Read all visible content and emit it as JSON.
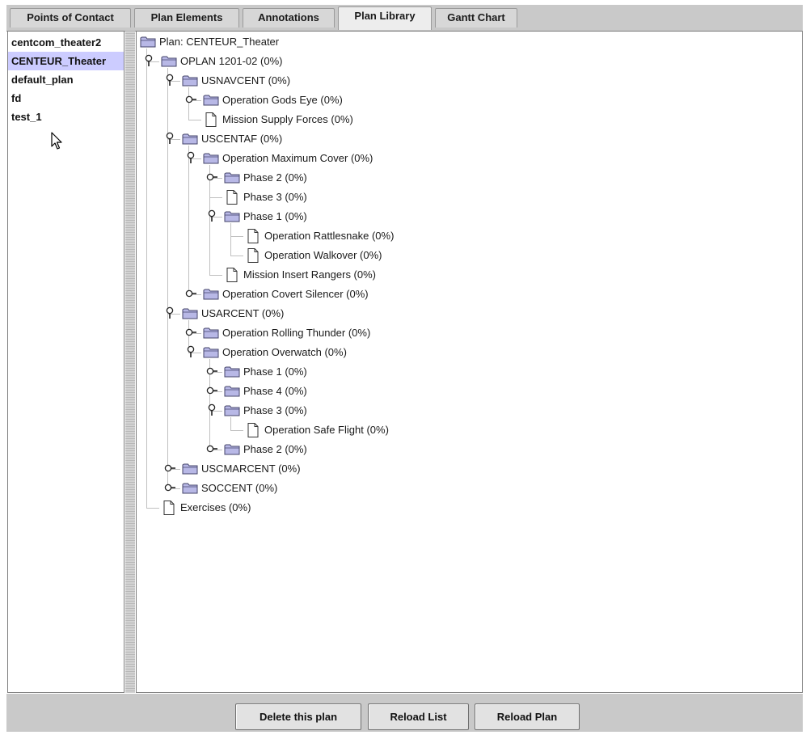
{
  "tabs": [
    {
      "label": "Points of Contact",
      "active": false
    },
    {
      "label": "Plan Elements",
      "active": false
    },
    {
      "label": "Annotations",
      "active": false
    },
    {
      "label": "Plan Library",
      "active": true
    },
    {
      "label": "Gantt Chart",
      "active": false
    }
  ],
  "plan_list": {
    "items": [
      {
        "label": "centcom_theater2",
        "selected": false
      },
      {
        "label": "CENTEUR_Theater",
        "selected": true
      },
      {
        "label": "default_plan",
        "selected": false
      },
      {
        "label": "fd",
        "selected": false
      },
      {
        "label": "test_1",
        "selected": false
      }
    ]
  },
  "tree": {
    "nodes": [
      {
        "label": "Plan: CENTEUR_Theater",
        "depth": 0,
        "icon": "folder-icon",
        "handle": "none"
      },
      {
        "label": "OPLAN 1201-02 (0%)",
        "depth": 1,
        "icon": "folder-icon",
        "handle": "expanded"
      },
      {
        "label": "USNAVCENT (0%)",
        "depth": 2,
        "icon": "folder-icon",
        "handle": "expanded"
      },
      {
        "label": "Operation Gods Eye (0%)",
        "depth": 3,
        "icon": "folder-icon",
        "handle": "collapsed"
      },
      {
        "label": "Mission Supply Forces (0%)",
        "depth": 3,
        "icon": "document-icon",
        "handle": "none"
      },
      {
        "label": "USCENTAF (0%)",
        "depth": 2,
        "icon": "folder-icon",
        "handle": "expanded"
      },
      {
        "label": "Operation Maximum Cover (0%)",
        "depth": 3,
        "icon": "folder-icon",
        "handle": "expanded"
      },
      {
        "label": "Phase 2 (0%)",
        "depth": 4,
        "icon": "folder-icon",
        "handle": "collapsed"
      },
      {
        "label": "Phase 3 (0%)",
        "depth": 4,
        "icon": "document-icon",
        "handle": "none"
      },
      {
        "label": "Phase 1 (0%)",
        "depth": 4,
        "icon": "folder-icon",
        "handle": "expanded"
      },
      {
        "label": "Operation Rattlesnake (0%)",
        "depth": 5,
        "icon": "document-icon",
        "handle": "none"
      },
      {
        "label": "Operation Walkover (0%)",
        "depth": 5,
        "icon": "document-icon",
        "handle": "none"
      },
      {
        "label": "Mission Insert Rangers (0%)",
        "depth": 4,
        "icon": "document-icon",
        "handle": "none"
      },
      {
        "label": "Operation Covert Silencer (0%)",
        "depth": 3,
        "icon": "folder-icon",
        "handle": "collapsed"
      },
      {
        "label": "USARCENT (0%)",
        "depth": 2,
        "icon": "folder-icon",
        "handle": "expanded"
      },
      {
        "label": "Operation Rolling Thunder (0%)",
        "depth": 3,
        "icon": "folder-icon",
        "handle": "collapsed"
      },
      {
        "label": "Operation Overwatch (0%)",
        "depth": 3,
        "icon": "folder-icon",
        "handle": "expanded"
      },
      {
        "label": "Phase 1 (0%)",
        "depth": 4,
        "icon": "folder-icon",
        "handle": "collapsed"
      },
      {
        "label": "Phase 4 (0%)",
        "depth": 4,
        "icon": "folder-icon",
        "handle": "collapsed"
      },
      {
        "label": "Phase 3 (0%)",
        "depth": 4,
        "icon": "folder-icon",
        "handle": "expanded"
      },
      {
        "label": "Operation Safe Flight (0%)",
        "depth": 5,
        "icon": "document-icon",
        "handle": "none"
      },
      {
        "label": "Phase 2 (0%)",
        "depth": 4,
        "icon": "folder-icon",
        "handle": "collapsed"
      },
      {
        "label": "USCMARCENT (0%)",
        "depth": 2,
        "icon": "folder-icon",
        "handle": "collapsed"
      },
      {
        "label": "SOCCENT (0%)",
        "depth": 2,
        "icon": "folder-icon",
        "handle": "collapsed"
      },
      {
        "label": "Exercises (0%)",
        "depth": 1,
        "icon": "document-icon",
        "handle": "none"
      }
    ]
  },
  "buttons": {
    "delete": "Delete this plan",
    "reload_list": "Reload List",
    "reload_plan": "Reload Plan"
  },
  "colors": {
    "selection": "#ccccff",
    "folder_fill": "#b8b8e6",
    "folder_stroke": "#44446a",
    "panel_bg": "#c9c9c9"
  }
}
